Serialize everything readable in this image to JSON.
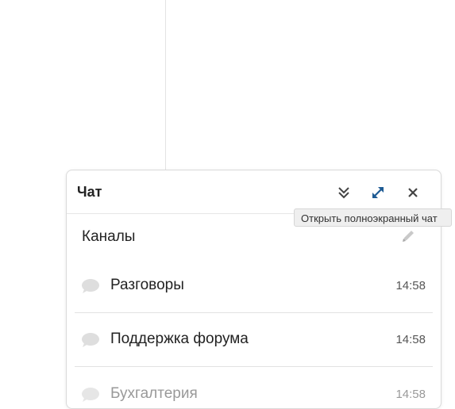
{
  "chat": {
    "title": "Чат",
    "buttons": {
      "collapse_icon": "double-chevron-down-icon",
      "fullscreen_icon": "expand-arrows-icon",
      "close_icon": "close-icon"
    },
    "tooltip": "Открыть полноэкранный чат",
    "channels_title": "Каналы",
    "channels": [
      {
        "name": "Разговоры",
        "time": "14:58"
      },
      {
        "name": "Поддержка форума",
        "time": "14:58"
      },
      {
        "name": "Бухгалтерия",
        "time": "14:58"
      }
    ]
  },
  "colors": {
    "accent": "#1e5b94",
    "icon_grey": "#444444",
    "muted_icon": "#d9d9d9"
  }
}
